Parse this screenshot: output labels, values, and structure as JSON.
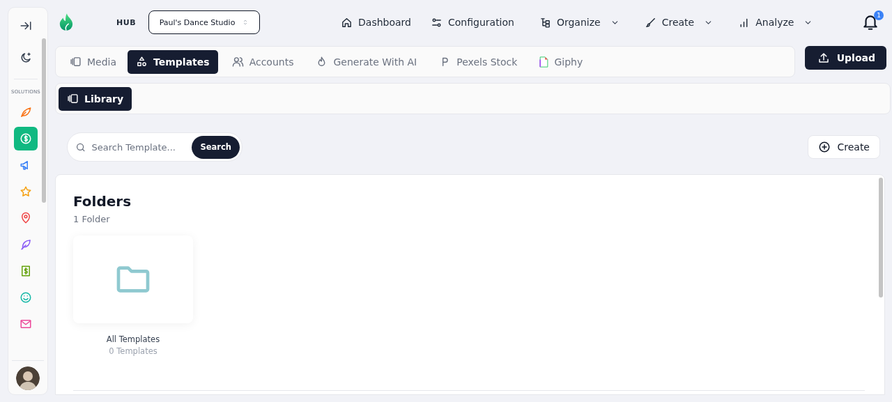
{
  "sidebar": {
    "section_label": "SOLUTIONS",
    "items": [
      {
        "color": "#f97316",
        "selected": false
      },
      {
        "color": "#10b981",
        "selected": true
      },
      {
        "color": "#3b82f6",
        "selected": false
      },
      {
        "color": "#f59e0b",
        "selected": false
      },
      {
        "color": "#ef4444",
        "selected": false
      },
      {
        "color": "#8b5cf6",
        "selected": false
      },
      {
        "color": "#65a30d",
        "selected": false
      },
      {
        "color": "#14b8a6",
        "selected": false
      },
      {
        "color": "#ec4899",
        "selected": false
      }
    ]
  },
  "header": {
    "hub_label": "HUB",
    "studio_select": "Paul's Dance Studio",
    "nav": [
      {
        "label": "Dashboard",
        "dropdown": false
      },
      {
        "label": "Configuration",
        "dropdown": false
      },
      {
        "label": "Organize",
        "dropdown": true
      },
      {
        "label": "Create",
        "dropdown": true
      },
      {
        "label": "Analyze",
        "dropdown": true
      }
    ],
    "notification_count": "1"
  },
  "tabs": [
    {
      "label": "Media",
      "selected": false
    },
    {
      "label": "Templates",
      "selected": true
    },
    {
      "label": "Accounts",
      "selected": false
    },
    {
      "label": "Generate With AI",
      "selected": false
    },
    {
      "label": "Pexels Stock",
      "selected": false
    },
    {
      "label": "Giphy",
      "selected": false
    }
  ],
  "upload_button": "Upload",
  "subtabs": [
    {
      "label": "Library",
      "selected": true
    }
  ],
  "search": {
    "placeholder": "Search Template...",
    "button": "Search"
  },
  "create_button": "Create",
  "folders": {
    "title": "Folders",
    "count": "1 Folder",
    "items": [
      {
        "name": "All Templates",
        "count": "0 Templates"
      }
    ]
  }
}
